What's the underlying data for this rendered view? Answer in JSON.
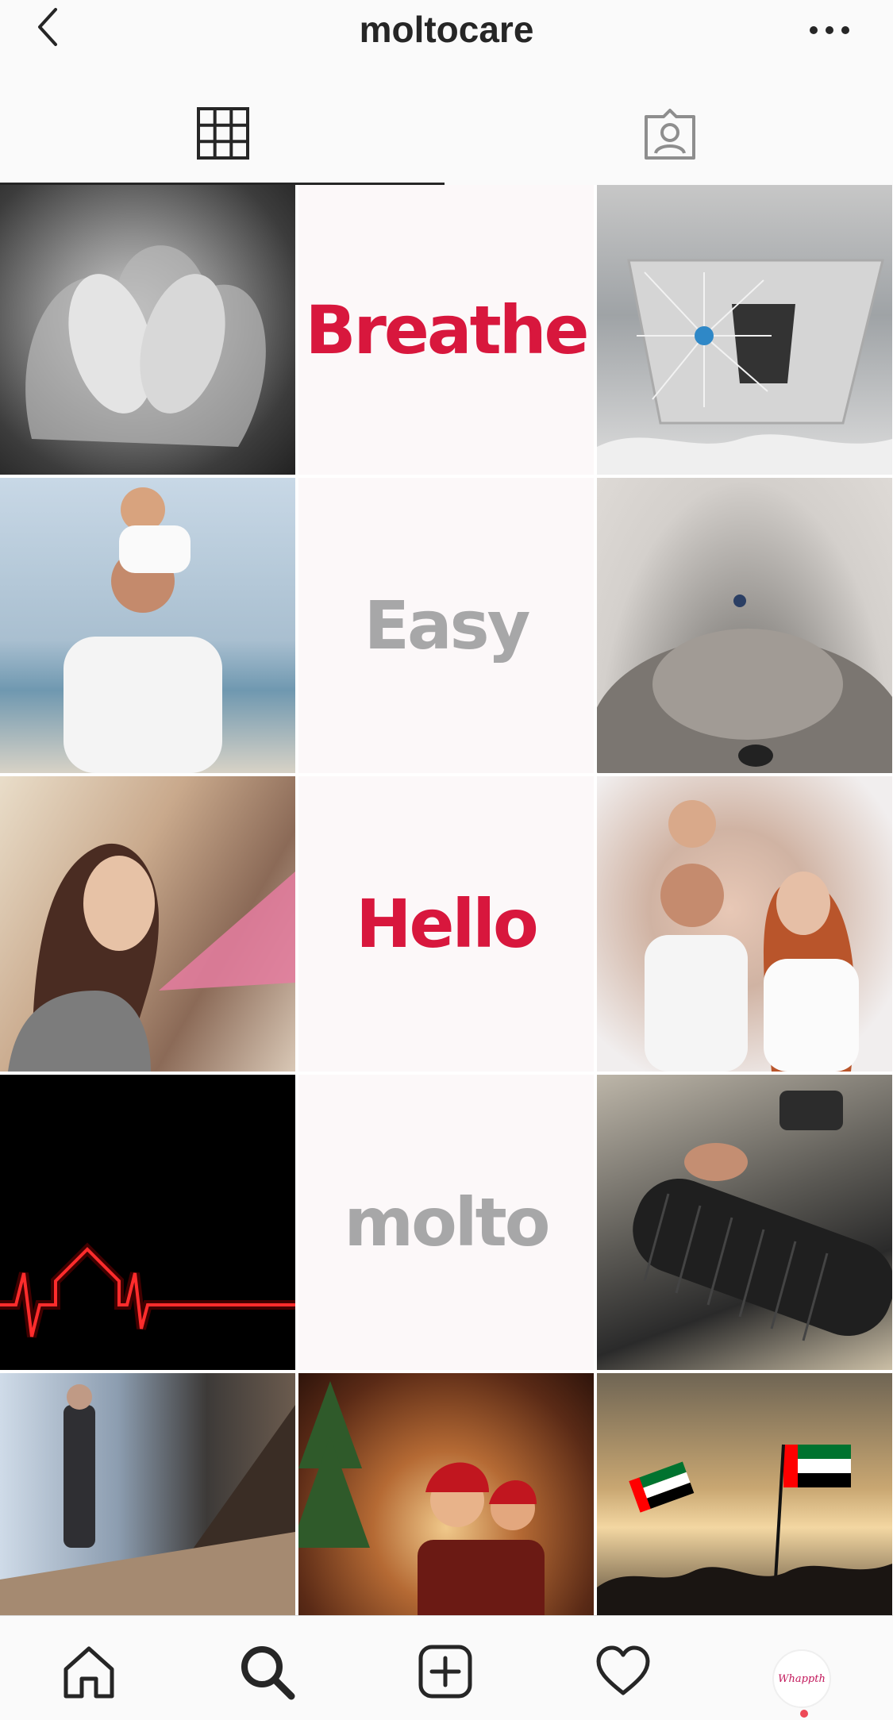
{
  "header": {
    "username": "moltocare",
    "back_icon": "chevron-left-icon",
    "more_icon": "more-horizontal-icon"
  },
  "tabs": [
    {
      "name": "grid",
      "icon": "grid-icon",
      "active": true
    },
    {
      "name": "tagged",
      "icon": "tagged-user-icon",
      "active": false
    }
  ],
  "posts": [
    {
      "type": "photo",
      "desc": "baby feet in hands"
    },
    {
      "type": "text",
      "text": "Breathe",
      "color": "#d8173d"
    },
    {
      "type": "photo",
      "desc": "air duct fan"
    },
    {
      "type": "photo",
      "desc": "father and daughter at beach"
    },
    {
      "type": "text",
      "text": "Easy",
      "color": "#a7a7a8"
    },
    {
      "type": "photo",
      "desc": "sleeping dog"
    },
    {
      "type": "photo",
      "desc": "woman with fan"
    },
    {
      "type": "text",
      "text": "Hello",
      "color": "#d8173d"
    },
    {
      "type": "photo",
      "desc": "happy family"
    },
    {
      "type": "photo",
      "desc": "heartbeat house line"
    },
    {
      "type": "text",
      "text": "molto",
      "color": "#a7a7a8"
    },
    {
      "type": "photo",
      "desc": "pressure washing blower"
    },
    {
      "type": "photo",
      "desc": "meeting room"
    },
    {
      "type": "photo",
      "desc": "christmas family"
    },
    {
      "type": "photo",
      "desc": "UAE flags"
    }
  ],
  "nav": {
    "home_icon": "home-icon",
    "search_icon": "search-icon",
    "add_icon": "add-post-icon",
    "activity_icon": "heart-icon",
    "profile_avatar_text": "Whappth",
    "profile_dot_color": "#ed4956"
  }
}
